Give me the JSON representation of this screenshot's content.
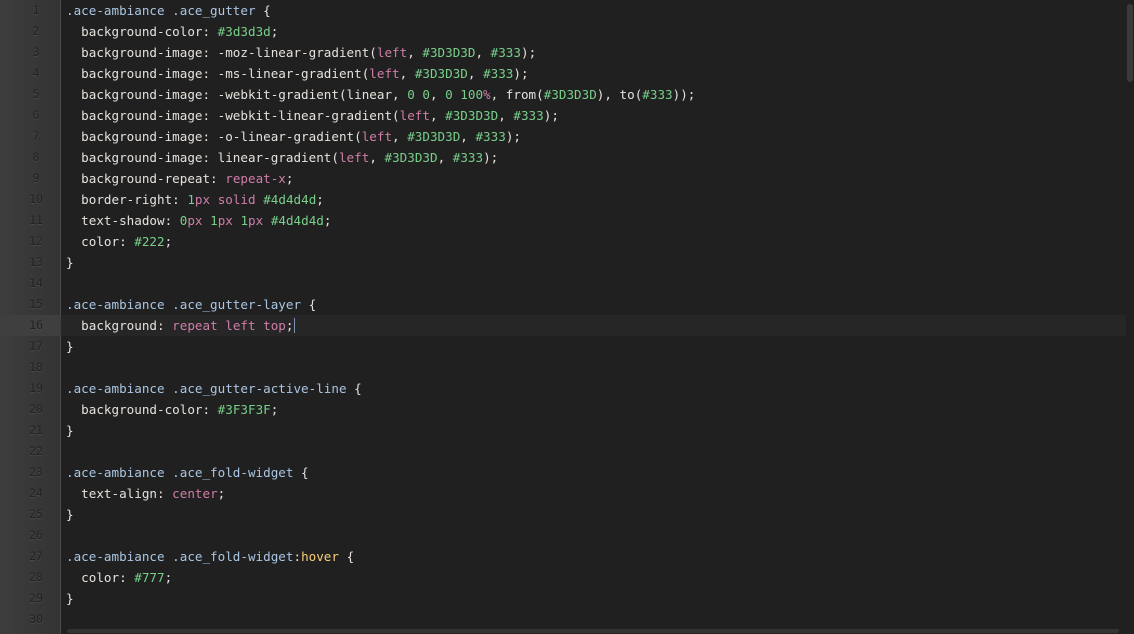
{
  "editor": {
    "theme": "ambiance",
    "active_line": 16,
    "gutter": {
      "line_numbers": [
        "1",
        "2",
        "3",
        "4",
        "5",
        "6",
        "7",
        "8",
        "9",
        "10",
        "11",
        "12",
        "13",
        "14",
        "15",
        "16",
        "17",
        "18",
        "19",
        "20",
        "21",
        "22",
        "23",
        "24",
        "25",
        "26",
        "27",
        "28",
        "29",
        "30"
      ]
    },
    "lines": [
      [
        {
          "t": ".ace-ambiance .ace_gutter",
          "c": "sel"
        },
        {
          "t": " {",
          "c": "punc"
        }
      ],
      [
        {
          "t": "  background-color: ",
          "c": "prop"
        },
        {
          "t": "#3d3d3d",
          "c": "col"
        },
        {
          "t": ";",
          "c": "punc"
        }
      ],
      [
        {
          "t": "  background-image: -moz-linear-gradient(",
          "c": "fn"
        },
        {
          "t": "left",
          "c": "str"
        },
        {
          "t": ", ",
          "c": "punc"
        },
        {
          "t": "#3D3D3D",
          "c": "col"
        },
        {
          "t": ", ",
          "c": "punc"
        },
        {
          "t": "#333",
          "c": "col"
        },
        {
          "t": ");",
          "c": "punc"
        }
      ],
      [
        {
          "t": "  background-image: -ms-linear-gradient(",
          "c": "fn"
        },
        {
          "t": "left",
          "c": "str"
        },
        {
          "t": ", ",
          "c": "punc"
        },
        {
          "t": "#3D3D3D",
          "c": "col"
        },
        {
          "t": ", ",
          "c": "punc"
        },
        {
          "t": "#333",
          "c": "col"
        },
        {
          "t": ");",
          "c": "punc"
        }
      ],
      [
        {
          "t": "  background-image: -webkit-gradient(linear, ",
          "c": "fn"
        },
        {
          "t": "0 0",
          "c": "num"
        },
        {
          "t": ", ",
          "c": "punc"
        },
        {
          "t": "0 100",
          "c": "num"
        },
        {
          "t": "%",
          "c": "unit"
        },
        {
          "t": ", from(",
          "c": "fn"
        },
        {
          "t": "#3D3D3D",
          "c": "col"
        },
        {
          "t": "), to(",
          "c": "fn"
        },
        {
          "t": "#333",
          "c": "col"
        },
        {
          "t": "));",
          "c": "punc"
        }
      ],
      [
        {
          "t": "  background-image: -webkit-linear-gradient(",
          "c": "fn"
        },
        {
          "t": "left",
          "c": "str"
        },
        {
          "t": ", ",
          "c": "punc"
        },
        {
          "t": "#3D3D3D",
          "c": "col"
        },
        {
          "t": ", ",
          "c": "punc"
        },
        {
          "t": "#333",
          "c": "col"
        },
        {
          "t": ");",
          "c": "punc"
        }
      ],
      [
        {
          "t": "  background-image: -o-linear-gradient(",
          "c": "fn"
        },
        {
          "t": "left",
          "c": "str"
        },
        {
          "t": ", ",
          "c": "punc"
        },
        {
          "t": "#3D3D3D",
          "c": "col"
        },
        {
          "t": ", ",
          "c": "punc"
        },
        {
          "t": "#333",
          "c": "col"
        },
        {
          "t": ");",
          "c": "punc"
        }
      ],
      [
        {
          "t": "  background-image: linear-gradient(",
          "c": "fn"
        },
        {
          "t": "left",
          "c": "str"
        },
        {
          "t": ", ",
          "c": "punc"
        },
        {
          "t": "#3D3D3D",
          "c": "col"
        },
        {
          "t": ", ",
          "c": "punc"
        },
        {
          "t": "#333",
          "c": "col"
        },
        {
          "t": ");",
          "c": "punc"
        }
      ],
      [
        {
          "t": "  background-repeat: ",
          "c": "prop"
        },
        {
          "t": "repeat-x",
          "c": "str"
        },
        {
          "t": ";",
          "c": "punc"
        }
      ],
      [
        {
          "t": "  border-right: ",
          "c": "prop"
        },
        {
          "t": "1",
          "c": "num"
        },
        {
          "t": "px",
          "c": "unit"
        },
        {
          "t": " ",
          "c": "punc"
        },
        {
          "t": "solid",
          "c": "str"
        },
        {
          "t": " ",
          "c": "punc"
        },
        {
          "t": "#4d4d4d",
          "c": "col"
        },
        {
          "t": ";",
          "c": "punc"
        }
      ],
      [
        {
          "t": "  text-shadow: ",
          "c": "prop"
        },
        {
          "t": "0",
          "c": "num"
        },
        {
          "t": "px",
          "c": "unit"
        },
        {
          "t": " ",
          "c": "punc"
        },
        {
          "t": "1",
          "c": "num"
        },
        {
          "t": "px",
          "c": "unit"
        },
        {
          "t": " ",
          "c": "punc"
        },
        {
          "t": "1",
          "c": "num"
        },
        {
          "t": "px",
          "c": "unit"
        },
        {
          "t": " ",
          "c": "punc"
        },
        {
          "t": "#4d4d4d",
          "c": "col"
        },
        {
          "t": ";",
          "c": "punc"
        }
      ],
      [
        {
          "t": "  color: ",
          "c": "prop"
        },
        {
          "t": "#222",
          "c": "col"
        },
        {
          "t": ";",
          "c": "punc"
        }
      ],
      [
        {
          "t": "}",
          "c": "punc"
        }
      ],
      [],
      [
        {
          "t": ".ace-ambiance .ace_gutter-layer",
          "c": "sel"
        },
        {
          "t": " {",
          "c": "punc"
        }
      ],
      [
        {
          "t": "  background: ",
          "c": "prop"
        },
        {
          "t": "repeat left top",
          "c": "str"
        },
        {
          "t": ";",
          "c": "punc"
        }
      ],
      [
        {
          "t": "}",
          "c": "punc"
        }
      ],
      [],
      [
        {
          "t": ".ace-ambiance .ace_gutter-active-line",
          "c": "sel"
        },
        {
          "t": " {",
          "c": "punc"
        }
      ],
      [
        {
          "t": "  background-color: ",
          "c": "prop"
        },
        {
          "t": "#3F3F3F",
          "c": "col"
        },
        {
          "t": ";",
          "c": "punc"
        }
      ],
      [
        {
          "t": "}",
          "c": "punc"
        }
      ],
      [],
      [
        {
          "t": ".ace-ambiance .ace_fold-widget",
          "c": "sel"
        },
        {
          "t": " {",
          "c": "punc"
        }
      ],
      [
        {
          "t": "  text-align: ",
          "c": "prop"
        },
        {
          "t": "center",
          "c": "str"
        },
        {
          "t": ";",
          "c": "punc"
        }
      ],
      [
        {
          "t": "}",
          "c": "punc"
        }
      ],
      [],
      [
        {
          "t": ".ace-ambiance .ace_fold-widget",
          "c": "sel"
        },
        {
          "t": ":",
          "c": "punc"
        },
        {
          "t": "hover",
          "c": "kw"
        },
        {
          "t": " {",
          "c": "punc"
        }
      ],
      [
        {
          "t": "  color: ",
          "c": "prop"
        },
        {
          "t": "#777",
          "c": "col"
        },
        {
          "t": ";",
          "c": "punc"
        }
      ],
      [
        {
          "t": "}",
          "c": "punc"
        }
      ],
      []
    ]
  }
}
